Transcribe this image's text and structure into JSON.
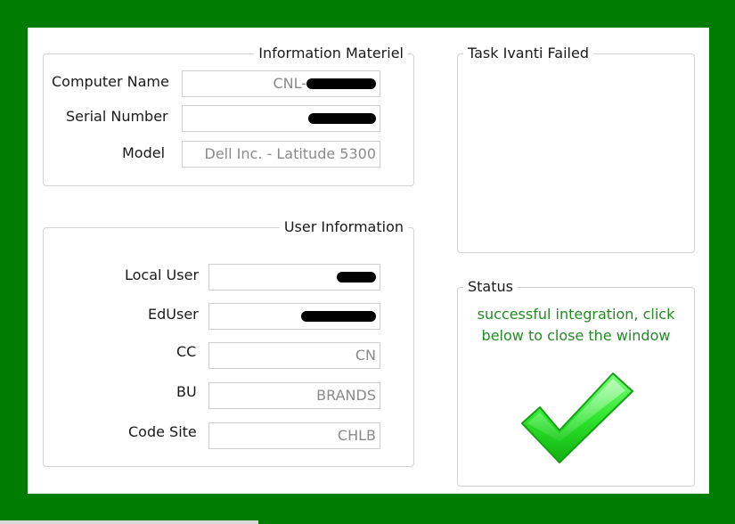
{
  "info_materiel": {
    "title": "Information Materiel",
    "computer_name_label": "Computer Name",
    "computer_name_value": "CNL-",
    "serial_label": "Serial Number",
    "serial_value": "",
    "model_label": "Model",
    "model_value": "Dell Inc. - Latitude 5300"
  },
  "user_info": {
    "title": "User Information",
    "local_user_label": "Local User",
    "local_user_value": "",
    "eduser_label": "EdUser",
    "eduser_value": "",
    "cc_label": "CC",
    "cc_value": "CN",
    "bu_label": "BU",
    "bu_value": "BRANDS",
    "code_site_label": "Code Site",
    "code_site_value": "CHLB"
  },
  "task_ivanti": {
    "title": "Task Ivanti Failed"
  },
  "status": {
    "title": "Status",
    "message_line1": "successful integration, click",
    "message_line2": "below to close the window"
  },
  "colors": {
    "frame_green": "#007d00",
    "status_text_green": "#228b22",
    "check_green": "#2ee62e"
  },
  "icons": {
    "close_action": "checkmark-icon"
  }
}
